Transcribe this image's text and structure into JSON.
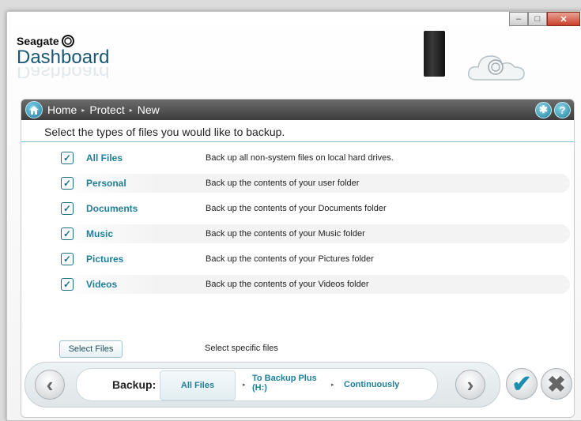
{
  "window": {
    "minimize": "–",
    "maximize": "□",
    "close": "✕"
  },
  "brand": {
    "company": "Seagate",
    "app": "Dashboard"
  },
  "nav": {
    "crumbs": [
      "Home",
      "Protect",
      "New"
    ],
    "separator": "▸"
  },
  "main": {
    "instruction": "Select the types of files you would like to backup.",
    "rows": [
      {
        "label": "All Files",
        "desc": "Back up all non-system files on local hard drives.",
        "checked": true
      },
      {
        "label": "Personal",
        "desc": "Back up the contents of your user folder",
        "checked": true
      },
      {
        "label": "Documents",
        "desc": "Back up the contents of your Documents folder",
        "checked": true
      },
      {
        "label": "Music",
        "desc": "Back up the contents of your Music folder",
        "checked": true
      },
      {
        "label": "Pictures",
        "desc": "Back up the contents of your Pictures folder",
        "checked": true
      },
      {
        "label": "Videos",
        "desc": "Back up the contents of your Videos folder",
        "checked": true
      }
    ],
    "check_glyph": "✓",
    "select_files_label": "Select Files",
    "select_files_desc": "Select specific files"
  },
  "summary": {
    "prefix": "Backup:",
    "what": "All Files",
    "dest_line1": "To Backup Plus",
    "dest_line2": "(H:)",
    "schedule": "Continuously"
  },
  "controls": {
    "prev": "‹",
    "next": "›",
    "confirm": "✔",
    "cancel": "✖"
  },
  "colors": {
    "accent": "#1f7f99",
    "navbar": "#4a4a4a"
  }
}
